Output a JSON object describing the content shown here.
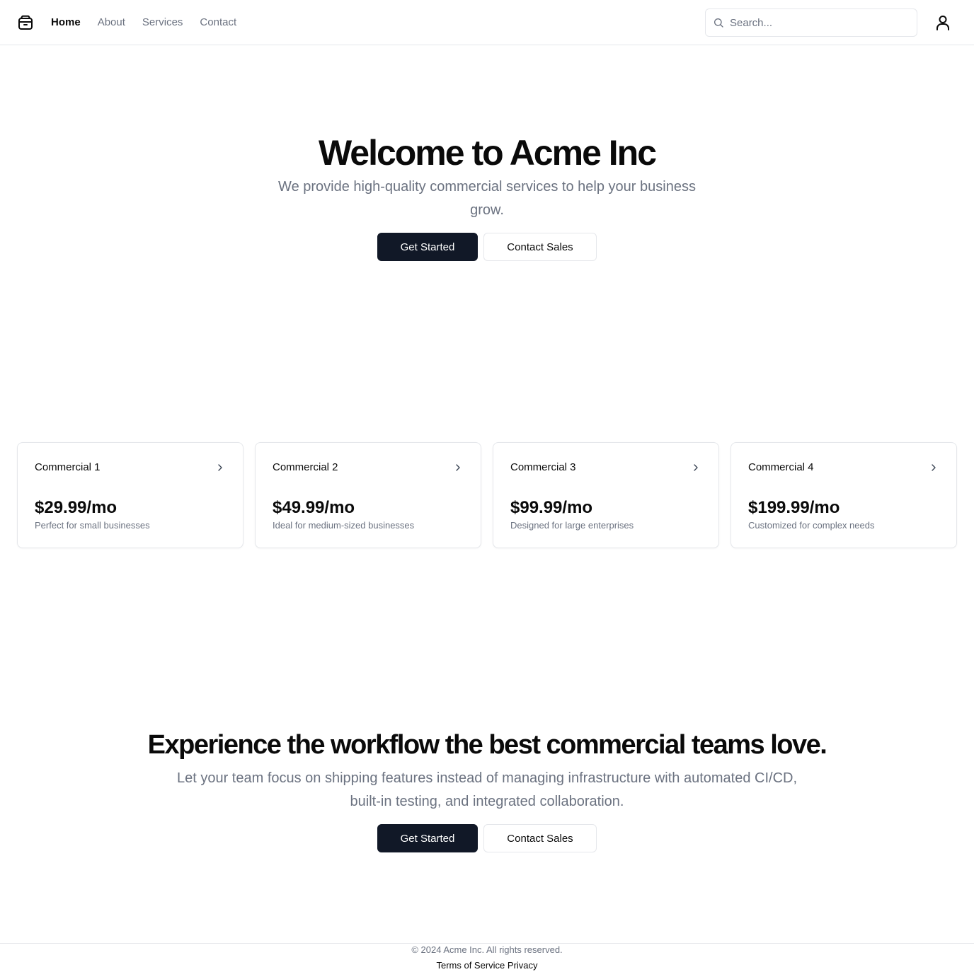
{
  "header": {
    "logo_icon": "package-icon",
    "nav": [
      {
        "label": "Home",
        "active": true
      },
      {
        "label": "About",
        "active": false
      },
      {
        "label": "Services",
        "active": false
      },
      {
        "label": "Contact",
        "active": false
      }
    ],
    "search": {
      "placeholder": "Search...",
      "value": "",
      "icon": "search-icon"
    },
    "user_icon": "user-icon"
  },
  "hero": {
    "title": "Welcome to Acme Inc",
    "subtitle": "We provide high-quality commercial services to help your business grow.",
    "primary_button": "Get Started",
    "secondary_button": "Contact Sales"
  },
  "cards": [
    {
      "name": "Commercial 1",
      "price": "$29.99/mo",
      "description": "Perfect for small businesses"
    },
    {
      "name": "Commercial 2",
      "price": "$49.99/mo",
      "description": "Ideal for medium-sized businesses"
    },
    {
      "name": "Commercial 3",
      "price": "$99.99/mo",
      "description": "Designed for large enterprises"
    },
    {
      "name": "Commercial 4",
      "price": "$199.99/mo",
      "description": "Customized for complex needs"
    }
  ],
  "cta": {
    "title": "Experience the workflow the best commercial teams love.",
    "subtitle": "Let your team focus on shipping features instead of managing infrastructure with automated CI/CD, built-in testing, and integrated collaboration.",
    "primary_button": "Get Started",
    "secondary_button": "Contact Sales"
  },
  "footer": {
    "copyright": "© 2024 Acme Inc. All rights reserved.",
    "links": [
      "Terms of Service",
      "Privacy"
    ]
  },
  "colors": {
    "primary": "#111827",
    "muted_text": "#6b7280",
    "border": "#e5e7eb",
    "text": "#0a0a0a"
  }
}
